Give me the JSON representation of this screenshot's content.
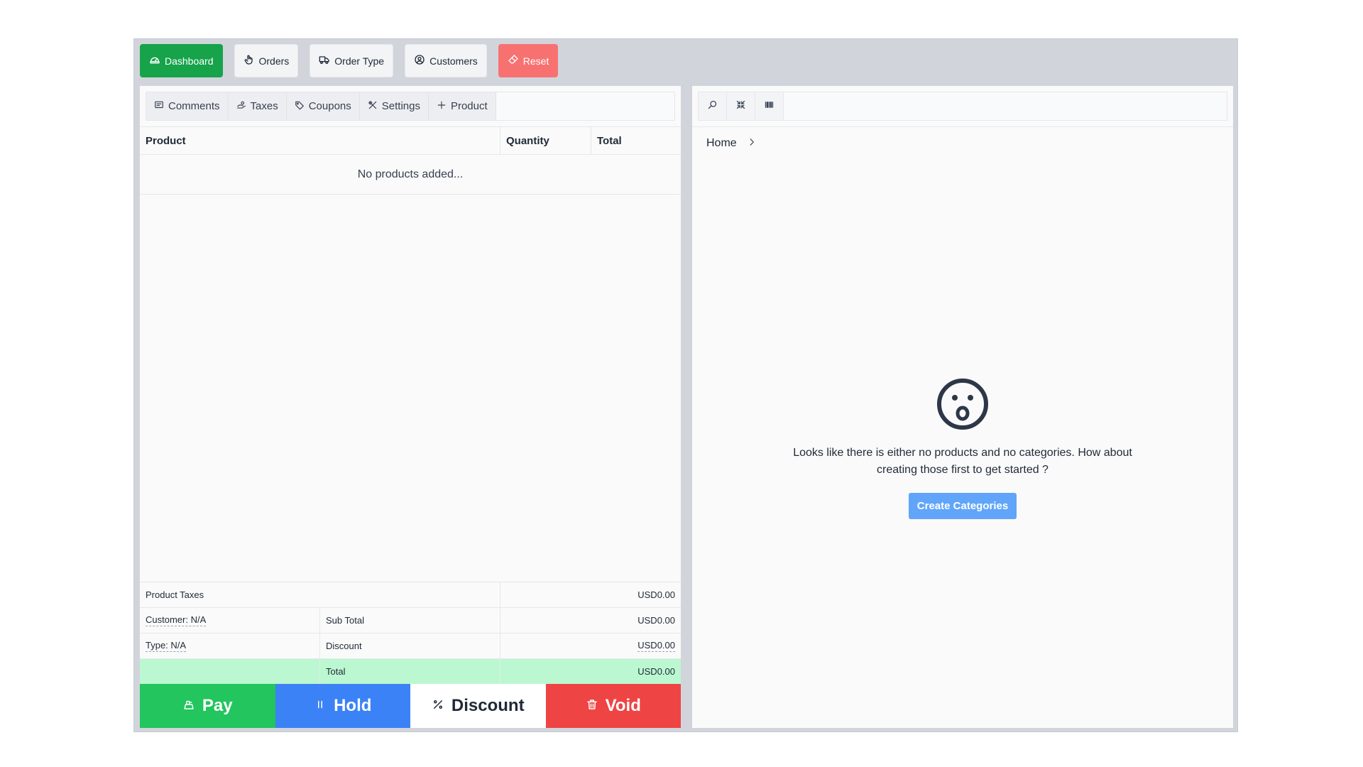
{
  "topnav": {
    "dashboard": "Dashboard",
    "orders": "Orders",
    "order_type": "Order Type",
    "customers": "Customers",
    "reset": "Reset"
  },
  "tabs": {
    "comments": "Comments",
    "taxes": "Taxes",
    "coupons": "Coupons",
    "settings": "Settings",
    "product": "Product"
  },
  "cart": {
    "columns": [
      "Product",
      "Quantity",
      "Total"
    ],
    "empty_text": "No products added..."
  },
  "summary": {
    "product_taxes_label": "Product Taxes",
    "product_taxes_value": "USD0.00",
    "customer": "Customer: N/A",
    "sub_total_label": "Sub Total",
    "sub_total_value": "USD0.00",
    "type": "Type: N/A",
    "discount_label": "Discount",
    "discount_value": "USD0.00",
    "total_label": "Total",
    "total_value": "USD0.00"
  },
  "actions": {
    "pay": "Pay",
    "hold": "Hold",
    "discount": "Discount",
    "void": "Void"
  },
  "right": {
    "search_placeholder": "",
    "breadcrumb_home": "Home",
    "empty_message": "Looks like there is either no products and no categories. How about creating those first to get started ?",
    "create_categories": "Create Categories"
  },
  "colors": {
    "dashboard_green": "#16a34a",
    "reset_red": "#f87171",
    "pay_green": "#22c55e",
    "hold_blue": "#3b82f6",
    "void_red": "#ef4444",
    "total_row_green": "#bbf7d0",
    "create_button_blue": "#60a5fa"
  }
}
